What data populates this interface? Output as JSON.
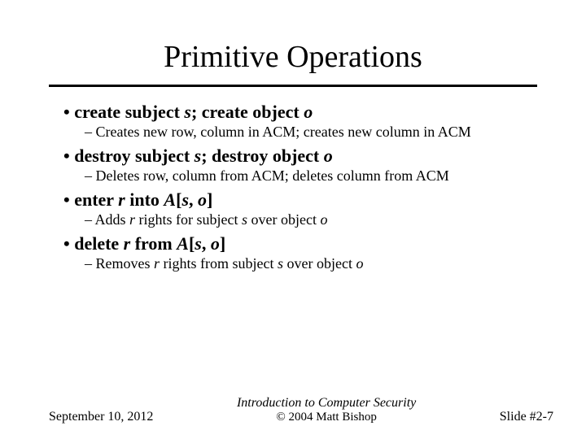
{
  "title": "Primitive Operations",
  "bullets": [
    {
      "line_pre": "create subject ",
      "var1": "s",
      "mid": "; create object ",
      "var2": "o",
      "post": "",
      "sub": "Creates new row, column in ACM; creates new column in ACM"
    },
    {
      "line_pre": "destroy subject ",
      "var1": "s",
      "mid": "; destroy object ",
      "var2": "o",
      "post": "",
      "sub": "Deletes row, column from ACM; deletes column from ACM"
    },
    {
      "line_pre": "enter ",
      "var1": "r",
      "mid": " into ",
      "var2": "A",
      "post_open": "[",
      "var3": "s",
      "sep": ", ",
      "var4": "o",
      "post_close": "]",
      "sub_pre": "Adds ",
      "sub_v1": "r",
      "sub_mid1": " rights for subject ",
      "sub_v2": "s",
      "sub_mid2": " over object ",
      "sub_v3": "o"
    },
    {
      "line_pre": "delete ",
      "var1": "r",
      "mid": " from ",
      "var2": "A",
      "post_open": "[",
      "var3": "s",
      "sep": ", ",
      "var4": "o",
      "post_close": "]",
      "sub_pre": "Removes ",
      "sub_v1": "r",
      "sub_mid1": " rights from subject ",
      "sub_v2": "s",
      "sub_mid2": " over object ",
      "sub_v3": "o"
    }
  ],
  "footer": {
    "date": "September 10, 2012",
    "center_title": "Introduction to Computer Security",
    "center_copy": "© 2004 Matt Bishop",
    "slide": "Slide #2-7"
  }
}
